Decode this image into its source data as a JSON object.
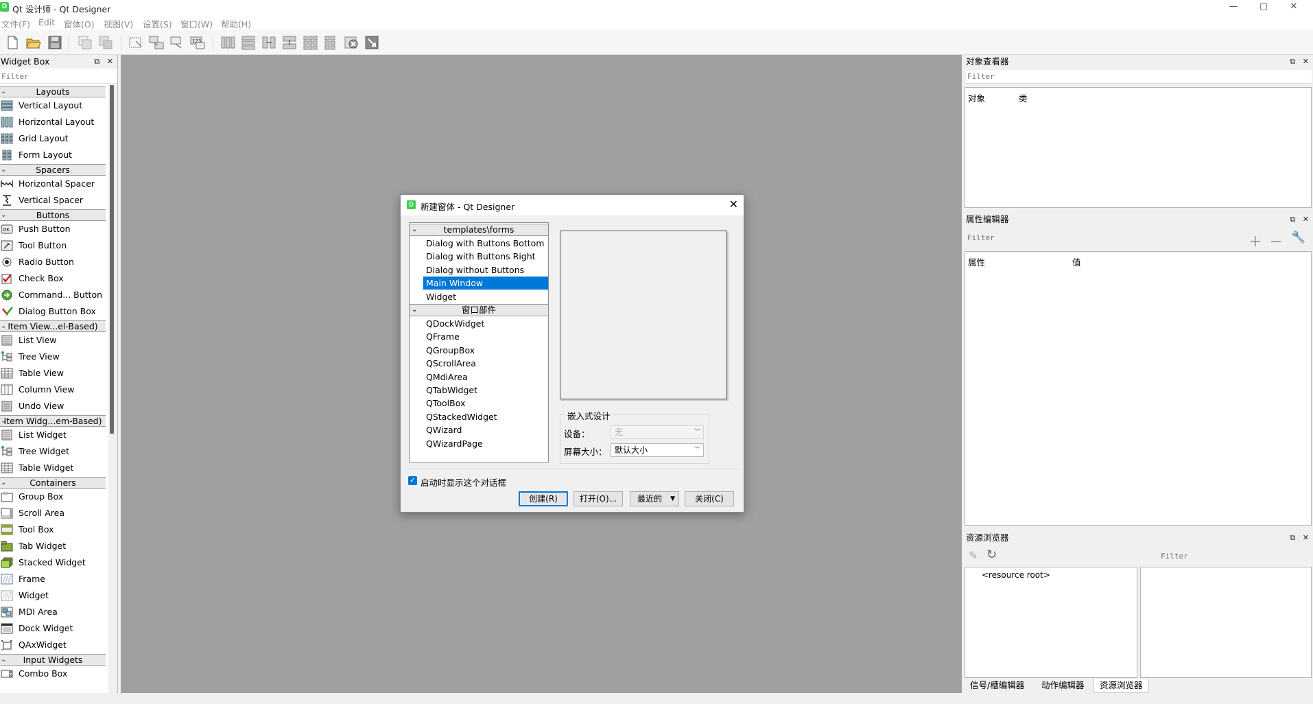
{
  "window": {
    "title": "Qt 设计师 - Qt Designer",
    "app_icon_letter": "D",
    "controls": {
      "minimize": "—",
      "maximize": "▢",
      "close": "✕"
    }
  },
  "menubar": [
    "文件(F)",
    "Edit",
    "窗体(O)",
    "视图(V)",
    "设置(S)",
    "窗口(W)",
    "帮助(H)"
  ],
  "widget_box": {
    "title": "Widget Box",
    "filter_placeholder": "Filter",
    "categories": [
      {
        "name": "Layouts",
        "items": [
          "Vertical Layout",
          "Horizontal Layout",
          "Grid Layout",
          "Form Layout"
        ]
      },
      {
        "name": "Spacers",
        "items": [
          "Horizontal Spacer",
          "Vertical Spacer"
        ]
      },
      {
        "name": "Buttons",
        "items": [
          "Push Button",
          "Tool Button",
          "Radio Button",
          "Check Box",
          "Command... Button",
          "Dialog Button Box"
        ]
      },
      {
        "name": "Item View...el-Based)",
        "items": [
          "List View",
          "Tree View",
          "Table View",
          "Column View",
          "Undo View"
        ]
      },
      {
        "name": "Item Widg...em-Based)",
        "items": [
          "List Widget",
          "Tree Widget",
          "Table Widget"
        ]
      },
      {
        "name": "Containers",
        "items": [
          "Group Box",
          "Scroll Area",
          "Tool Box",
          "Tab Widget",
          "Stacked Widget",
          "Frame",
          "Widget",
          "MDI Area",
          "Dock Widget",
          "QAxWidget"
        ]
      },
      {
        "name": "Input Widgets",
        "items": [
          "Combo Box"
        ]
      }
    ]
  },
  "object_inspector": {
    "title": "对象查看器",
    "filter_placeholder": "Filter",
    "col_object": "对象",
    "col_class": "类"
  },
  "property_editor": {
    "title": "属性编辑器",
    "filter_placeholder": "Filter",
    "col_property": "属性",
    "col_value": "值"
  },
  "resource_browser": {
    "title": "资源浏览器",
    "filter_placeholder": "Filter",
    "root": "<resource root>"
  },
  "bottom_tabs": [
    "信号/槽编辑器",
    "动作编辑器",
    "资源浏览器"
  ],
  "dialog": {
    "title": "新建窗体 - Qt Designer",
    "template_category": "templates\\forms",
    "templates": [
      "Dialog with Buttons Bottom",
      "Dialog with Buttons Right",
      "Dialog without Buttons",
      "Main Window",
      "Widget"
    ],
    "selected_template": "Main Window",
    "widget_category": "窗口部件",
    "widgets": [
      "QDockWidget",
      "QFrame",
      "QGroupBox",
      "QScrollArea",
      "QMdiArea",
      "QTabWidget",
      "QToolBox",
      "QStackedWidget",
      "QWizard",
      "QWizardPage"
    ],
    "embedded_design_title": "嵌入式设计",
    "device_label": "设备：",
    "device_value": "无",
    "screen_size_label": "屏幕大小：",
    "screen_size_value": "默认大小",
    "show_on_startup_label": "启动时显示这个对话框",
    "show_on_startup_checked": true,
    "buttons": {
      "create": "创建(R)",
      "open": "打开(O)...",
      "recent": "最近的",
      "close": "关闭(C)"
    }
  },
  "colors": {
    "accent": "#0078d7",
    "mdi_background": "#a0a0a0"
  }
}
